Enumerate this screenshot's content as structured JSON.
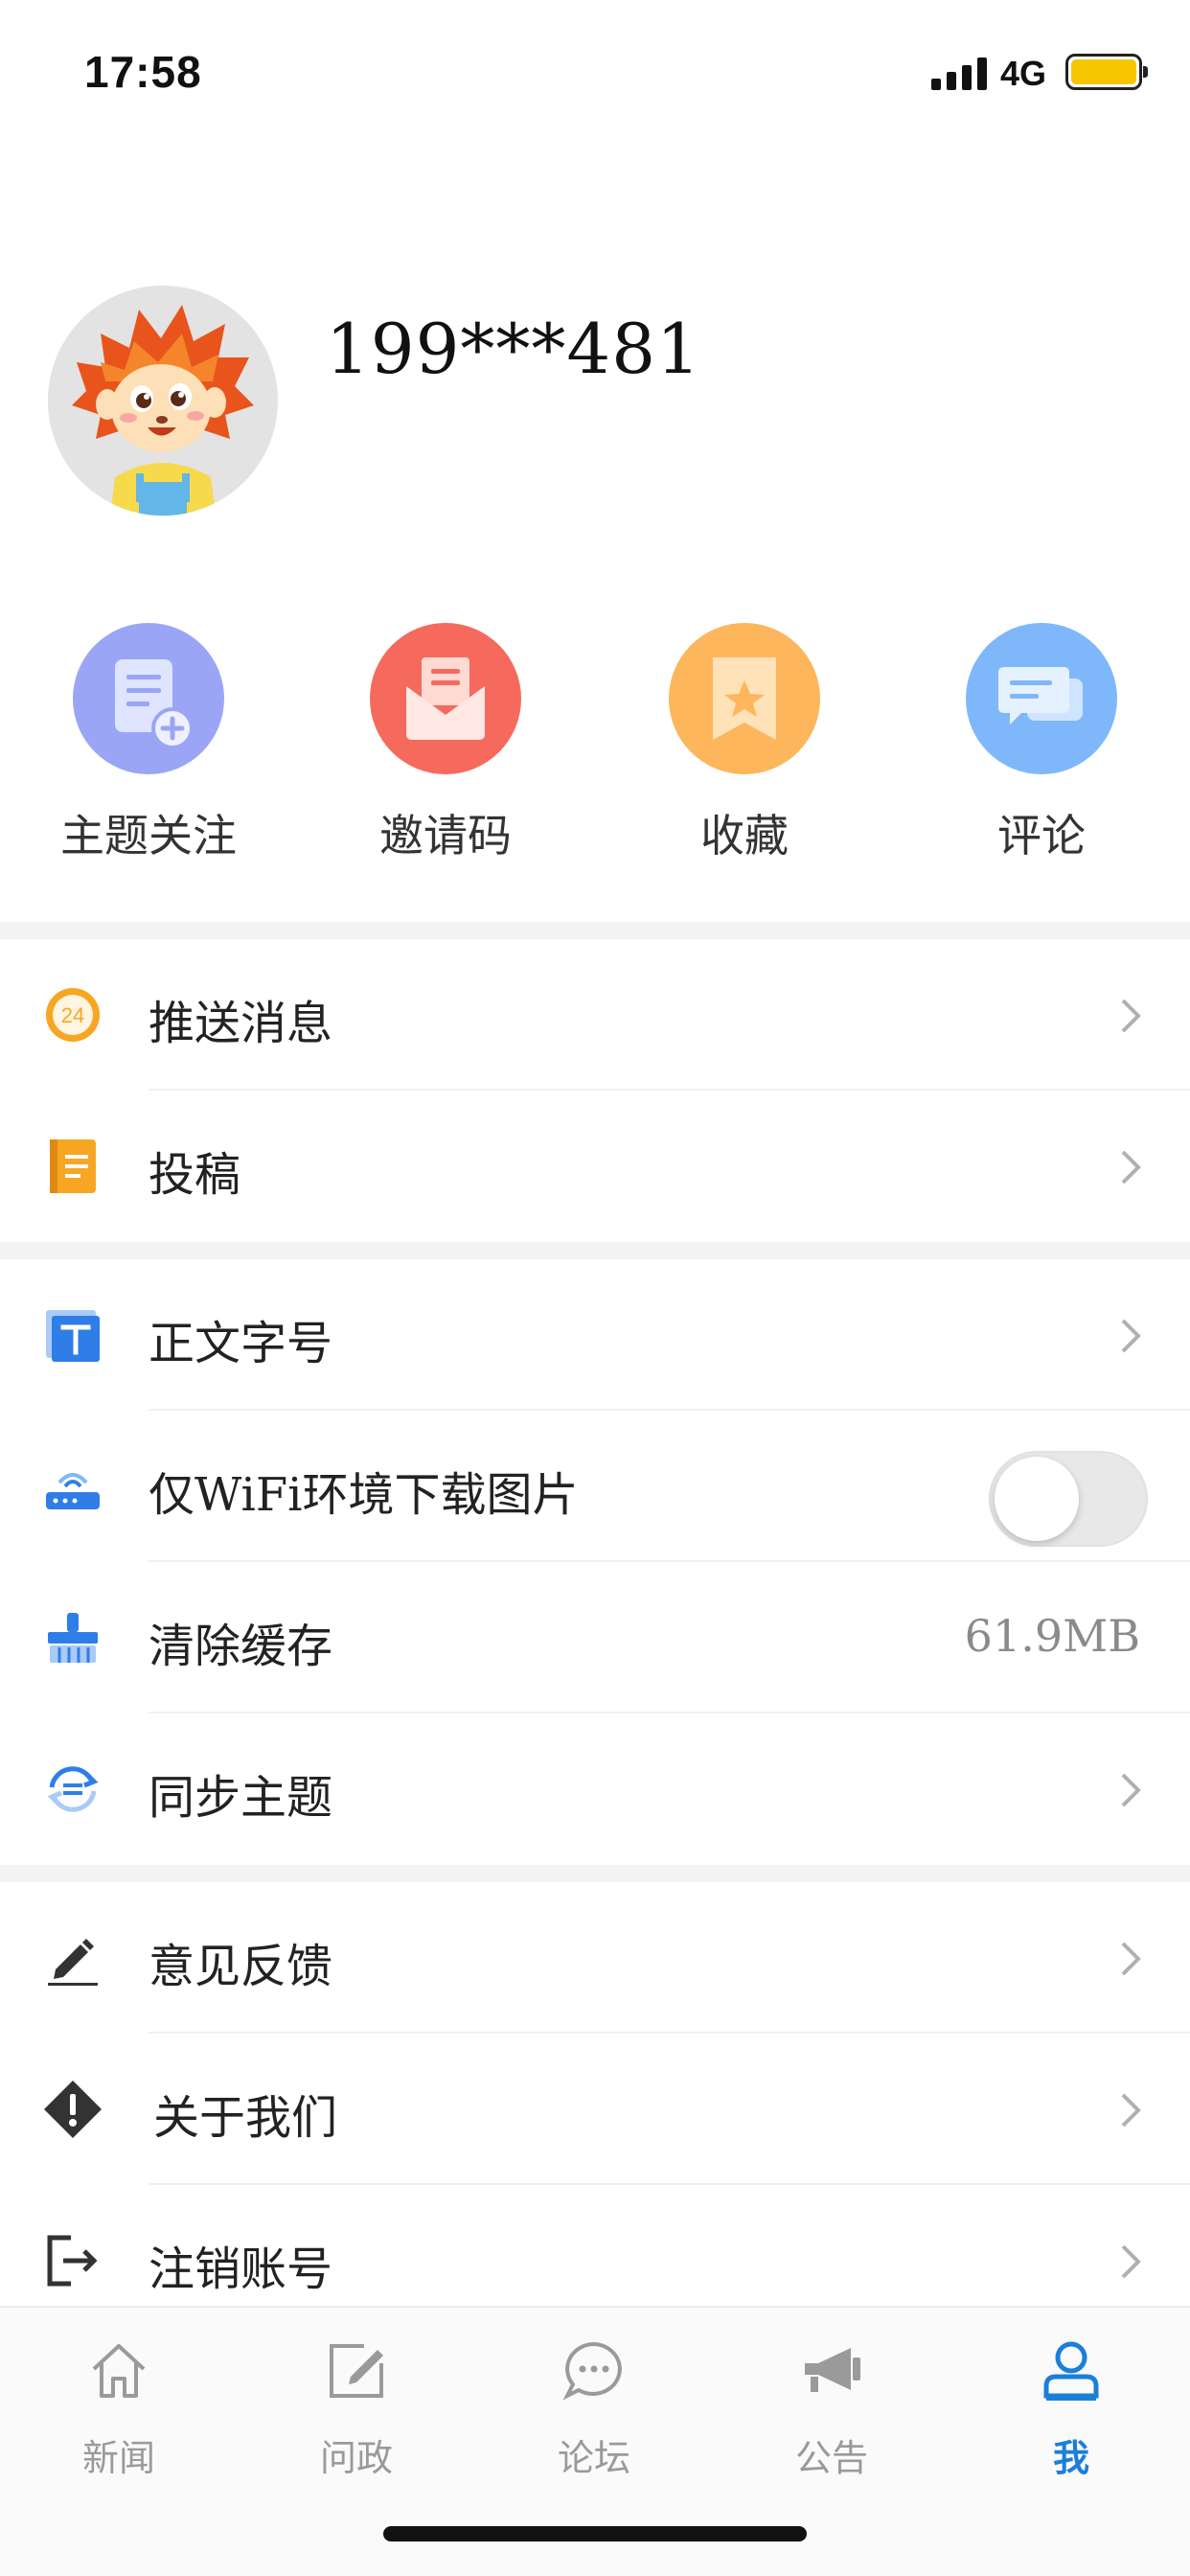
{
  "status_bar": {
    "time": "17:58",
    "network": "4G"
  },
  "profile": {
    "username": "199***481"
  },
  "quick_actions": [
    {
      "label": "主题关注",
      "icon": "doc-plus-icon",
      "color": "#9aa6f5"
    },
    {
      "label": "邀请码",
      "icon": "envelope-icon",
      "color": "#f56a5c"
    },
    {
      "label": "收藏",
      "icon": "bookmark-star-icon",
      "color": "#fdb65c"
    },
    {
      "label": "评论",
      "icon": "chat-bubbles-icon",
      "color": "#7fb8fa"
    }
  ],
  "settings": {
    "push_messages": "推送消息",
    "submit": "投稿",
    "font_size": "正文字号",
    "wifi_images": "仅WiFi环境下载图片",
    "wifi_images_enabled": false,
    "clear_cache": "清除缓存",
    "cache_size": "61.9MB",
    "sync_topics": "同步主题",
    "feedback": "意见反馈",
    "about_us": "关于我们",
    "deactivate": "注销账号",
    "push_badge": "24"
  },
  "tabbar": [
    {
      "label": "新闻",
      "icon": "home-icon",
      "active": false
    },
    {
      "label": "问政",
      "icon": "edit-icon",
      "active": false
    },
    {
      "label": "论坛",
      "icon": "chat-icon",
      "active": false
    },
    {
      "label": "公告",
      "icon": "megaphone-icon",
      "active": false
    },
    {
      "label": "我",
      "icon": "user-icon",
      "active": true
    }
  ],
  "colors": {
    "accent": "#1b7fd8",
    "inactive": "#9a9a9a"
  }
}
